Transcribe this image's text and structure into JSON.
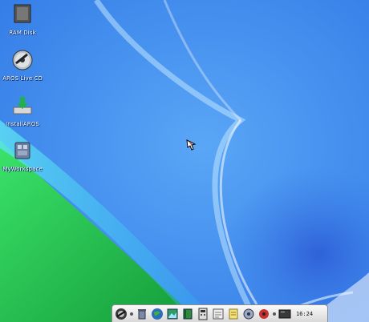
{
  "desktop": {
    "icons": [
      {
        "label": "RAM Disk",
        "icon": "ram-disk-icon"
      },
      {
        "label": "AROS Live CD",
        "icon": "cd-drive-icon"
      },
      {
        "label": "InstallAROS",
        "icon": "install-icon"
      },
      {
        "label": "MyWorkspace",
        "icon": "workspace-icon"
      }
    ]
  },
  "dock": {
    "items": [
      "aros-logo-icon",
      "separator",
      "trash-icon",
      "globe-icon",
      "image-viewer-icon",
      "book-icon",
      "calculator-icon",
      "text-editor-icon",
      "notes-icon",
      "system-prefs-icon",
      "media-player-icon",
      "separator",
      "shell-icon"
    ],
    "clock": "16:24"
  },
  "colors": {
    "sky": "#3f8ef0",
    "green": "#30c050",
    "dock": "#e8e8e8"
  }
}
